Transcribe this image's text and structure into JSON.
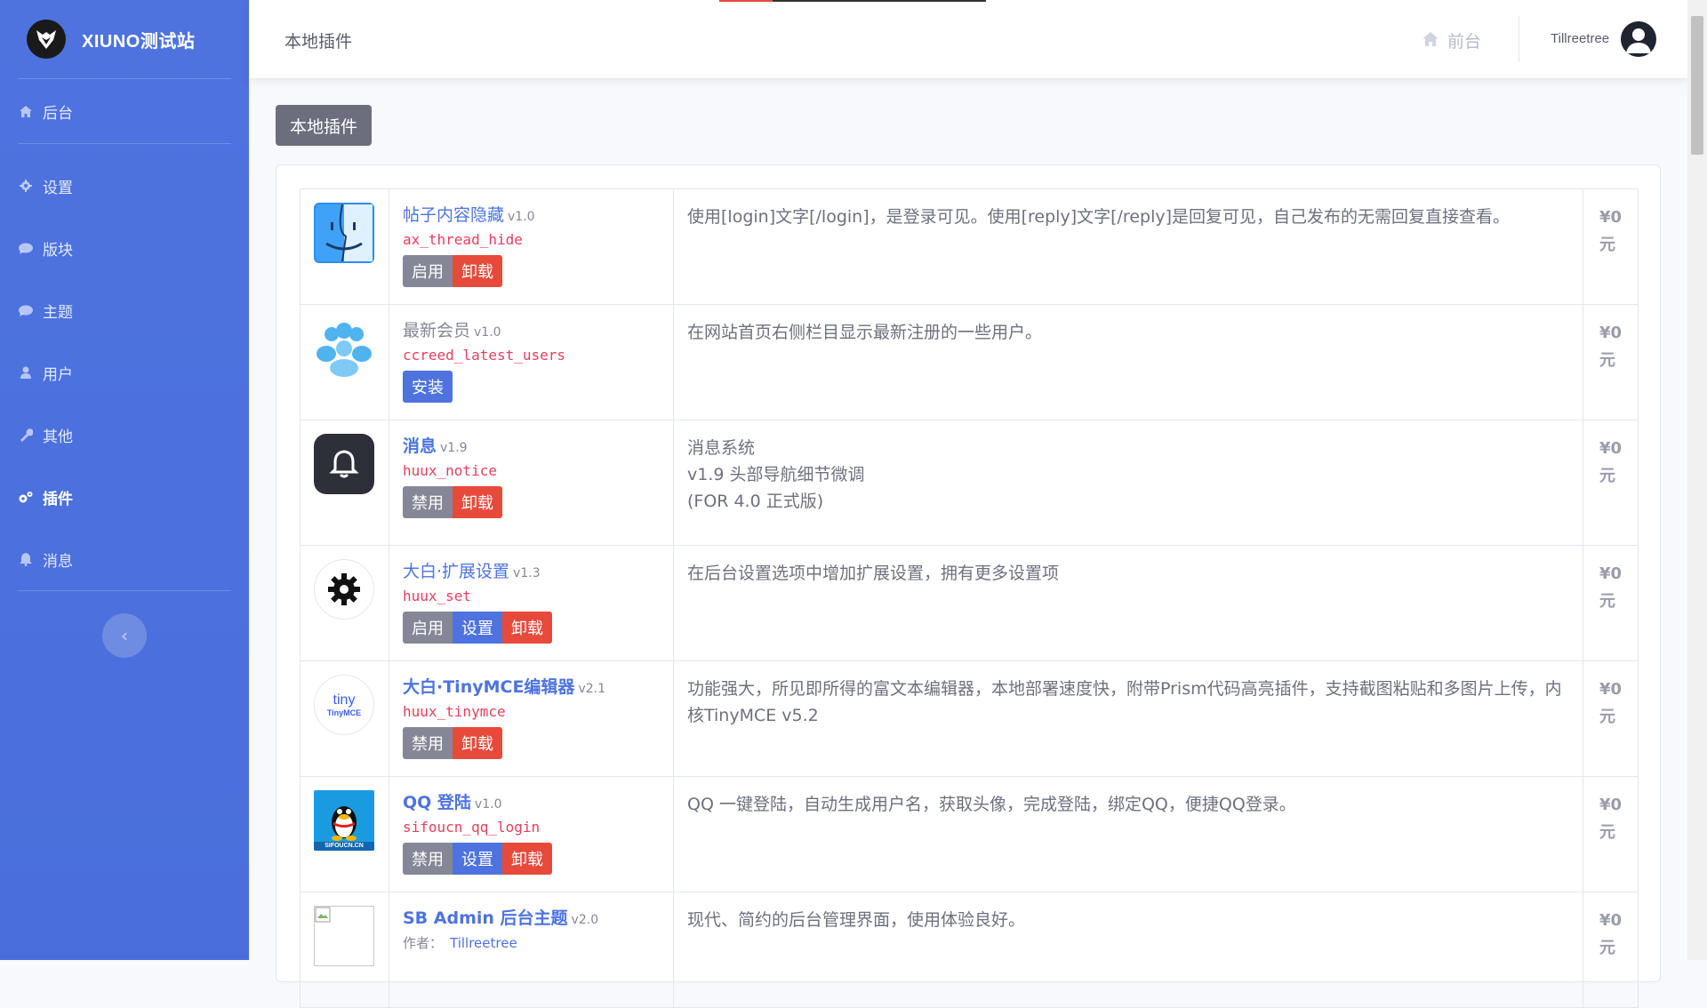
{
  "brand": {
    "name": "XIUNO测试站"
  },
  "sidebar": {
    "items": [
      {
        "label": "后台",
        "icon": "home-icon"
      },
      {
        "label": "设置",
        "icon": "gear-icon"
      },
      {
        "label": "版块",
        "icon": "comment-icon"
      },
      {
        "label": "主题",
        "icon": "comment-icon"
      },
      {
        "label": "用户",
        "icon": "user-icon"
      },
      {
        "label": "其他",
        "icon": "wrench-icon"
      },
      {
        "label": "插件",
        "icon": "cogs-icon",
        "active": true
      },
      {
        "label": "消息",
        "icon": "bell-icon"
      }
    ],
    "toggle_label": "‹"
  },
  "topbar": {
    "title": "本地插件",
    "front_label": "前台",
    "user_name": "Tillreetree"
  },
  "page": {
    "button_label": "本地插件"
  },
  "plugins": [
    {
      "name": "帖子内容隐藏",
      "version": "v1.0",
      "key": "ax_thread_hide",
      "buttons": [
        "启用",
        "卸载"
      ],
      "description": "使用[login]文字[/login]，是登录可见。使用[reply]文字[/reply]是回复可见，自己发布的无需回复直接查看。",
      "price": "¥0",
      "unit": "元"
    },
    {
      "name": "最新会员",
      "version": "v1.0",
      "key": "ccreed_latest_users",
      "buttons": [
        "安装"
      ],
      "description": "在网站首页右侧栏目显示最新注册的一些用户。",
      "price": "¥0",
      "unit": "元"
    },
    {
      "name": "消息",
      "version": "v1.9",
      "key": "huux_notice",
      "buttons": [
        "禁用",
        "卸载"
      ],
      "description_lines": [
        "消息系统",
        "v1.9 头部导航细节微调",
        "(FOR 4.0 正式版)"
      ],
      "price": "¥0",
      "unit": "元"
    },
    {
      "name": "大白·扩展设置",
      "version": "v1.3",
      "key": "huux_set",
      "buttons": [
        "启用",
        "设置",
        "卸载"
      ],
      "description": "在后台设置选项中增加扩展设置，拥有更多设置项",
      "price": "¥0",
      "unit": "元"
    },
    {
      "name": "大白·TinyMCE编辑器",
      "version": "v2.1",
      "key": "huux_tinymce",
      "buttons": [
        "禁用",
        "卸载"
      ],
      "description": "功能强大，所见即所得的富文本编辑器，本地部署速度快，附带Prism代码高亮插件，支持截图粘贴和多图片上传，内核TinyMCE v5.2",
      "price": "¥0",
      "unit": "元",
      "icon_text": "tiny",
      "icon_subtext": "TinyMCE"
    },
    {
      "name": "QQ 登陆",
      "version": "v1.0",
      "key": "sifoucn_qq_login",
      "buttons": [
        "禁用",
        "设置",
        "卸载"
      ],
      "description": "QQ 一键登陆，自动生成用户名，获取头像，完成登陆，绑定QQ，便捷QQ登录。",
      "price": "¥0",
      "unit": "元",
      "icon_text": "SIFOUCN.CN"
    },
    {
      "name": "SB Admin 后台主题",
      "version": "v2.0",
      "author_label": "作者：",
      "author": "Tillreetree",
      "description": "现代、简约的后台管理界面，使用体验良好。",
      "price": "¥0",
      "unit": "元"
    }
  ]
}
